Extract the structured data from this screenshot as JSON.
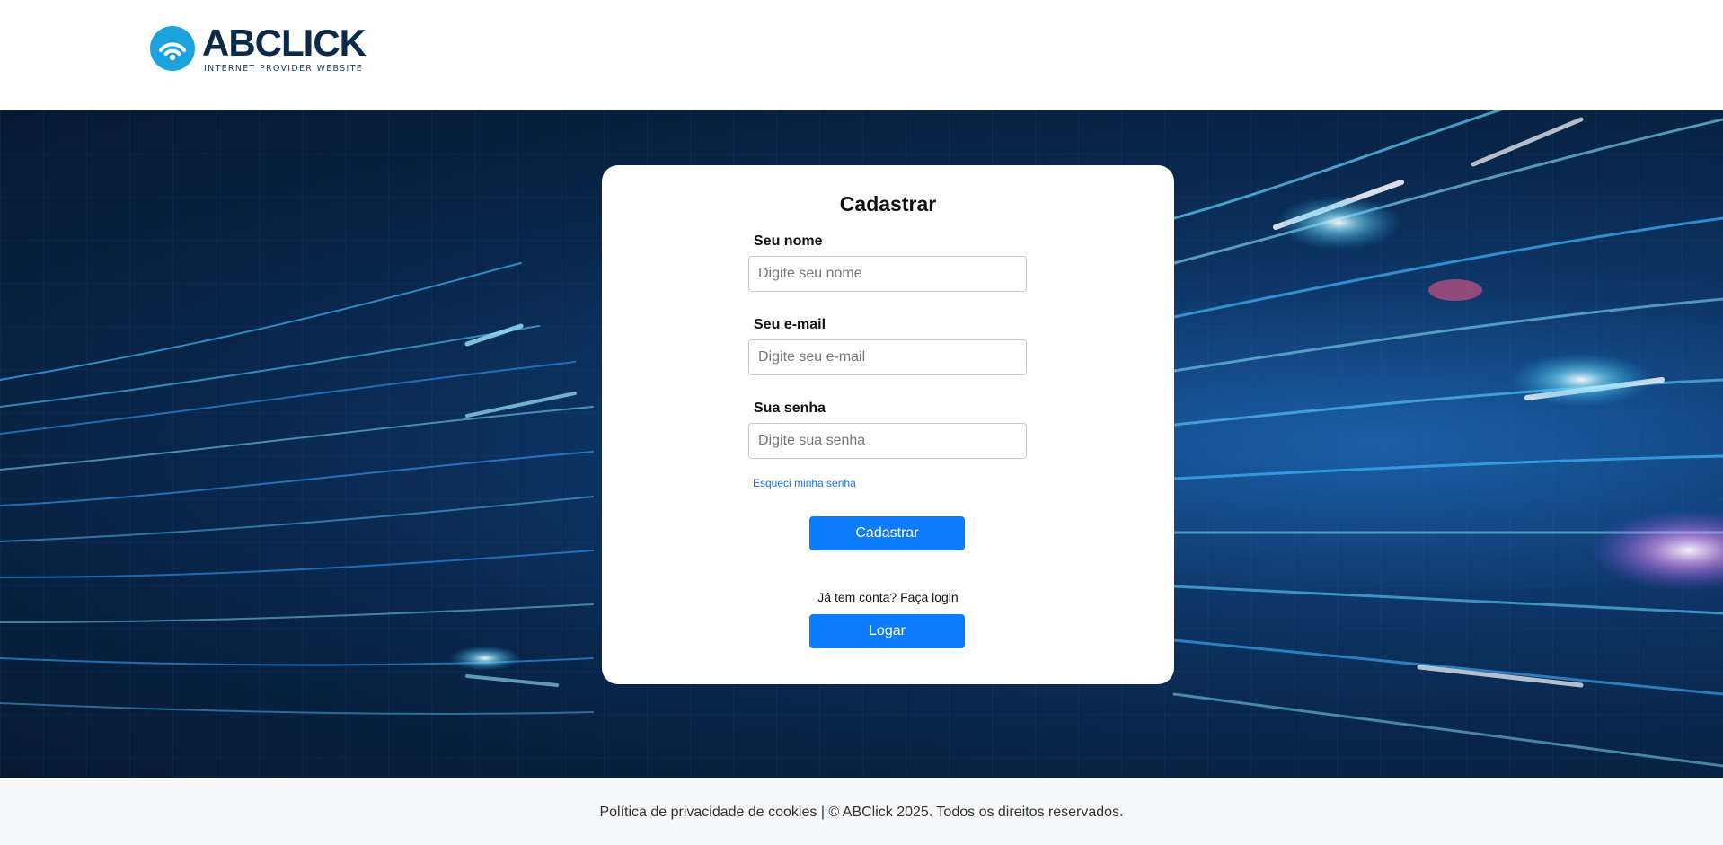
{
  "brand": {
    "name_part1": "AB",
    "name_part2": "CLICK",
    "tagline": "INTERNET PROVIDER WEBSITE",
    "icon": "wifi-icon",
    "colors": {
      "navy": "#0b2a4a",
      "cyan": "#1aa3dd"
    }
  },
  "form": {
    "title": "Cadastrar",
    "fields": [
      {
        "label": "Seu nome",
        "placeholder": "Digite seu nome",
        "value": ""
      },
      {
        "label": "Seu e-mail",
        "placeholder": "Digite seu e-mail",
        "value": ""
      },
      {
        "label": "Sua senha",
        "placeholder": "Digite sua senha",
        "value": ""
      }
    ],
    "forgot_label": "Esqueci minha senha",
    "submit_label": "Cadastrar",
    "login_prompt": "Já tem conta? Faça login",
    "login_label": "Logar",
    "accent_color": "#0d7bfd"
  },
  "footer": {
    "text": "Política de privacidade de cookies | © ABClick 2025. Todos os direitos reservados."
  }
}
